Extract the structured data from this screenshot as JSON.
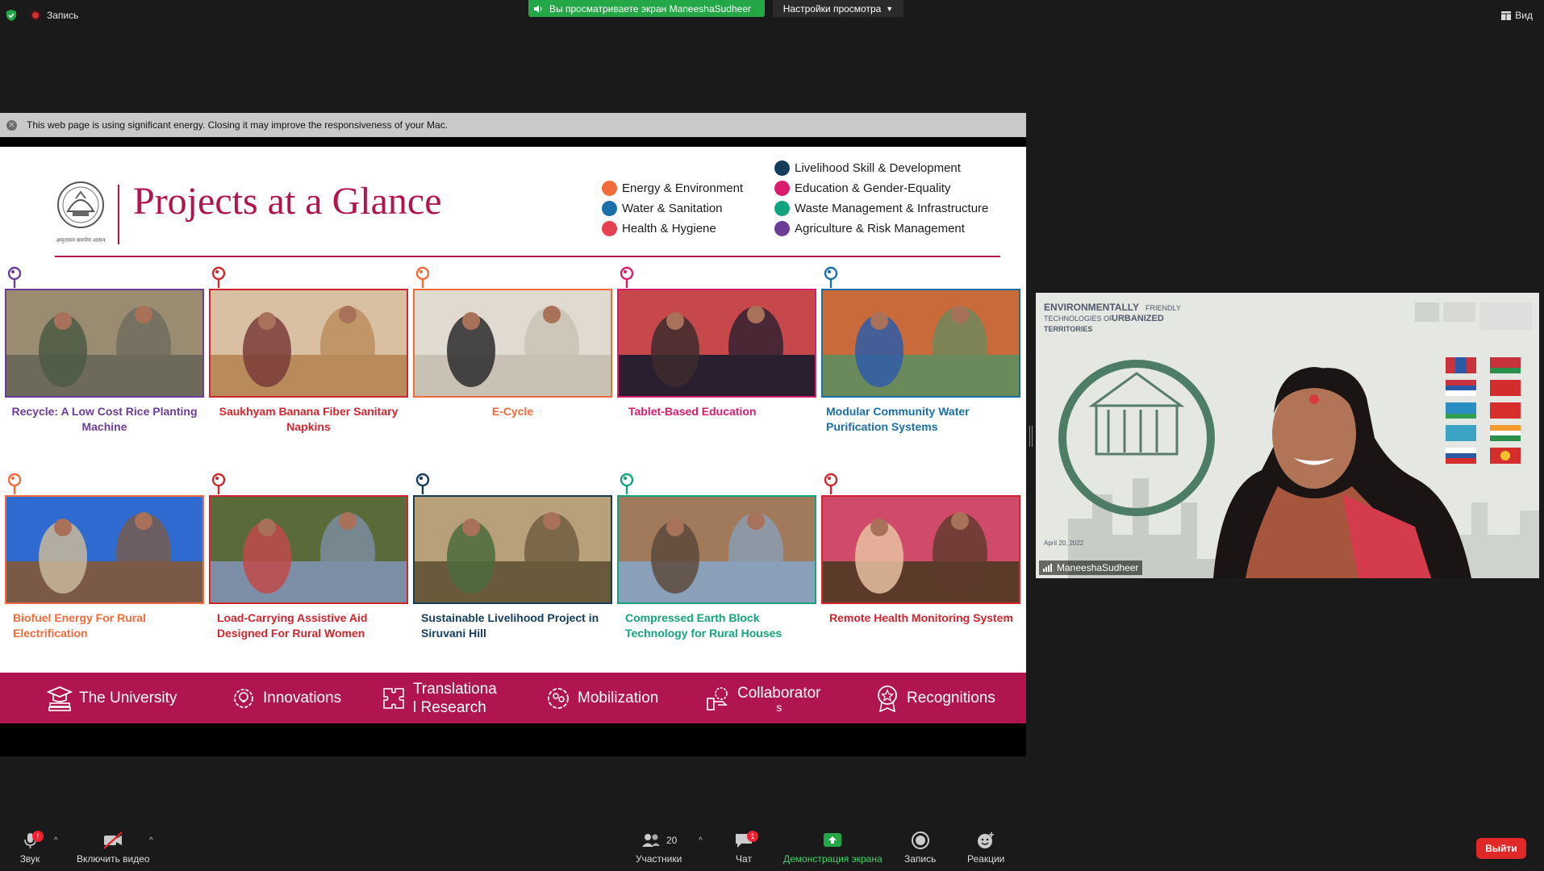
{
  "topbar": {
    "record_label": "Запись",
    "viewing_banner": "Вы просматриваете экран ManeeshaSudheer",
    "view_settings": "Настройки просмотра",
    "view_label": "Вид"
  },
  "energy_warning": "This web page is using significant energy. Closing it may improve the responsiveness of your Mac.",
  "slide": {
    "title": "Projects at a Glance",
    "logo_caption": "अमृतायन समर्पण शासन",
    "legend": [
      {
        "label": "Energy & Environment",
        "color": "#f26b3a"
      },
      {
        "label": "Water & Sanitation",
        "color": "#1a6fa8"
      },
      {
        "label": "Health & Hygiene",
        "color": "#e5414f"
      },
      {
        "label": "Livelihood Skill & Development",
        "color": "#143d5c"
      },
      {
        "label": "Education & Gender-Equality",
        "color": "#d81c6e"
      },
      {
        "label": "Waste Management & Infrastructure",
        "color": "#14a37f"
      },
      {
        "label": "Agriculture & Risk Management",
        "color": "#6b3d99"
      }
    ],
    "projects": [
      {
        "caption": "Recycle: A Low Cost Rice Planting Machine",
        "color": "#6b3d99"
      },
      {
        "caption": "Saukhyam Banana Fiber Sanitary Napkins",
        "color": "#d0262f"
      },
      {
        "caption": "E-Cycle",
        "color": "#f26b3a"
      },
      {
        "caption": "Tablet-Based Education",
        "color": "#d81c6e"
      },
      {
        "caption": "Modular Community Water Purification Systems",
        "color": "#1a6fa8"
      },
      {
        "caption": "Biofuel Energy For Rural Electrification",
        "color": "#f26b3a"
      },
      {
        "caption": "Load-Carrying Assistive Aid Designed For Rural Women",
        "color": "#d0262f"
      },
      {
        "caption": "Sustainable Livelihood Project in Siruvani Hill",
        "color": "#143d5c"
      },
      {
        "caption": "Compressed Earth Block Technology for Rural Houses",
        "color": "#14a37f"
      },
      {
        "caption": "Remote Health Monitoring System",
        "color": "#d0262f"
      }
    ],
    "nav": [
      {
        "line1": "The University",
        "line2": ""
      },
      {
        "line1": "Innovations",
        "line2": ""
      },
      {
        "line1": "Translationa",
        "line2": "l Research"
      },
      {
        "line1": "Mobilization",
        "line2": ""
      },
      {
        "line1": "Collaborator",
        "line2": "s"
      },
      {
        "line1": "Recognitions",
        "line2": ""
      }
    ]
  },
  "video": {
    "participant_name": "ManeeshaSudheer",
    "bg_title_1": "ENVIRONMENTALLY",
    "bg_title_1b": "FRIENDLY",
    "bg_title_2": "TECHNOLOGIES OF",
    "bg_title_2b": "URBANIZED",
    "bg_title_3": "TERRITORIES",
    "bg_date": "April 20, 2022"
  },
  "toolbar": {
    "audio": "Звук",
    "video": "Включить видео",
    "participants": "Участники",
    "participants_count": "20",
    "chat": "Чат",
    "chat_badge": "1",
    "share_screen": "Демонстрация экрана",
    "record": "Запись",
    "reactions": "Реакции",
    "leave": "Выйти"
  }
}
